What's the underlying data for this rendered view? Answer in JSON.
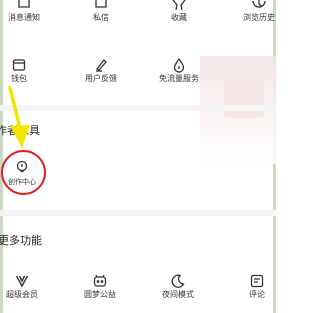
{
  "colors": {
    "annotation_circle": "#e02020",
    "annotation_arrow": "#f2e600",
    "icon": "#333333",
    "section_bg": "#f5f5f5"
  },
  "top_row": [
    {
      "label": "消息通知",
      "icon": "bell-icon"
    },
    {
      "label": "私信",
      "icon": "message-icon"
    },
    {
      "label": "收藏",
      "icon": "star-icon"
    },
    {
      "label": "浏览历史",
      "icon": "clock-icon"
    }
  ],
  "second_row": [
    {
      "label": "钱包",
      "icon": "wallet-icon"
    },
    {
      "label": "用户反馈",
      "icon": "feedback-pen-icon"
    },
    {
      "label": "免流量服务",
      "icon": "water-drop-icon"
    }
  ],
  "creator_tools": {
    "title": "作者工具",
    "items": [
      {
        "label": "创作中心",
        "icon": "lightbulb-icon"
      }
    ]
  },
  "more_features": {
    "title": "更多功能",
    "items": [
      {
        "label": "超级会员",
        "icon": "vip-v-icon"
      },
      {
        "label": "圆梦公益",
        "icon": "charity-box-icon"
      },
      {
        "label": "夜间模式",
        "icon": "moon-icon"
      },
      {
        "label": "评论",
        "icon": "comment-icon"
      }
    ]
  }
}
